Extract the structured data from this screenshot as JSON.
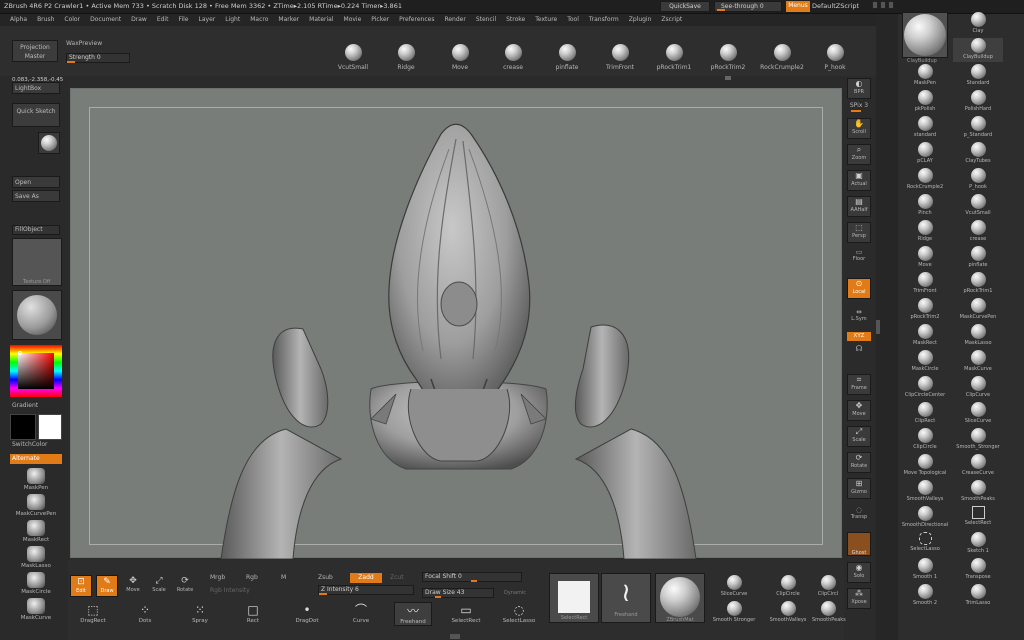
{
  "titlebar": {
    "text": "ZBrush 4R6 P2    Crawler1    • Active Mem 733 • Scratch Disk 128 • Free Mem 3362 • ZTime▸2.105 RTime▸0.224 Timer▸3.861",
    "quicksave": "QuickSave",
    "seethrough": "See-through  0",
    "menus": "Menus",
    "default_script": "DefaultZScript"
  },
  "menubar": [
    "Alpha",
    "Brush",
    "Color",
    "Document",
    "Draw",
    "Edit",
    "File",
    "Layer",
    "Light",
    "Macro",
    "Marker",
    "Material",
    "Movie",
    "Picker",
    "Preferences",
    "Render",
    "Stencil",
    "Stroke",
    "Texture",
    "Tool",
    "Transform",
    "Zplugin",
    "Zscript"
  ],
  "toolbar": {
    "projection_master": "Projection Master",
    "wax_preview": "WaxPreview",
    "strength": "Strength 0",
    "brushes": [
      "VcutSmall",
      "Ridge",
      "Move",
      "crease",
      "pinflate",
      "TrimFront",
      "pRockTrim1",
      "pRockTrim2",
      "RockCrumple2",
      "P_hook"
    ]
  },
  "left": {
    "coords": "0.083,-2.358,-0.45",
    "lightbox": "LightBox",
    "quick_sketch": "Quick Sketch",
    "open": "Open",
    "save_as": "Save As",
    "fill_object": "FillObject",
    "texture_off": "Texture Off",
    "gradient": "Gradient",
    "switch_color": "SwitchColor",
    "alternate": "Alternate",
    "brushes": [
      "MaskPen",
      "MaskCurvePen",
      "MaskRect",
      "MaskLasso",
      "MaskCircle",
      "MaskCurve"
    ]
  },
  "rightshelf": {
    "items": [
      "BPR",
      "SPix 3",
      "Scroll",
      "Zoom",
      "Actual",
      "AAHalf",
      "Persp",
      "Floor",
      "Local",
      "L.Sym",
      "XYZ",
      "Frame",
      "Move",
      "Scale",
      "Rotate",
      "Gizmo",
      "Transp",
      "Ghost",
      "Solo",
      "Xpose"
    ]
  },
  "rightpanel": {
    "brushes": [
      [
        "ClayBuildup",
        "Clay"
      ],
      [
        "",
        "ClayBuildup"
      ],
      [
        "MaskPen",
        "Standard"
      ],
      [
        "pkPolish",
        "PolishHard"
      ],
      [
        "standard",
        "p_Standard"
      ],
      [
        "pCLAY",
        "ClayTubes"
      ],
      [
        "RockCrumple2",
        "P_hook"
      ],
      [
        "Pinch",
        "VcutSmall"
      ],
      [
        "Ridge",
        "crease"
      ],
      [
        "Move",
        "pinflate"
      ],
      [
        "TrimFront",
        "pRockTrim1"
      ],
      [
        "pRockTrim2",
        "MaskCurvePen"
      ],
      [
        "MaskRect",
        "MaskLasso"
      ],
      [
        "MaskCircle",
        "MaskCurve"
      ],
      [
        "ClipCircleCenter",
        "ClipCurve"
      ],
      [
        "ClipRect",
        "SliceCurve"
      ],
      [
        "ClipCircle",
        "Smooth_Stronger"
      ],
      [
        "Move Topological",
        "CreaseCurve"
      ],
      [
        "SmoothValleys",
        "SmoothPeaks"
      ],
      [
        "SmoothDirectional",
        "SelectRect"
      ],
      [
        "SelectLasso",
        "Sketch 1"
      ],
      [
        "Smooth 1",
        "Transpose"
      ],
      [
        "Smooth 2",
        "TrimLasso"
      ]
    ]
  },
  "bottom": {
    "edit": "Edit",
    "draw": "Draw",
    "move": "Move",
    "scale": "Scale",
    "rotate": "Rotate",
    "mrgb": "Mrgb",
    "rgb": "Rgb",
    "m": "M",
    "rgb_intensity": "Rgb Intensity",
    "zsub": "Zsub",
    "zadd": "Zadd",
    "zcut": "Zcut",
    "z_intensity": "Z Intensity 6",
    "focal_shift": "Focal Shift 0",
    "draw_size": "Draw Size 43",
    "dynamic": "Dynamic",
    "strokes": [
      "DragRect",
      "Dots",
      "Spray",
      "Rect",
      "DragDot",
      "Curve",
      "Freehand",
      "SelectRect",
      "SelectLasso"
    ],
    "thumbs": [
      "SelectRect",
      "Freehand",
      "ZBrushMat"
    ],
    "brushes_top": [
      "SliceCurve",
      "ClipCircle",
      "ClipCircl"
    ],
    "brushes_bottom": [
      "Smooth Stronger",
      "SmoothValleys",
      "SmoothPeaks"
    ]
  }
}
